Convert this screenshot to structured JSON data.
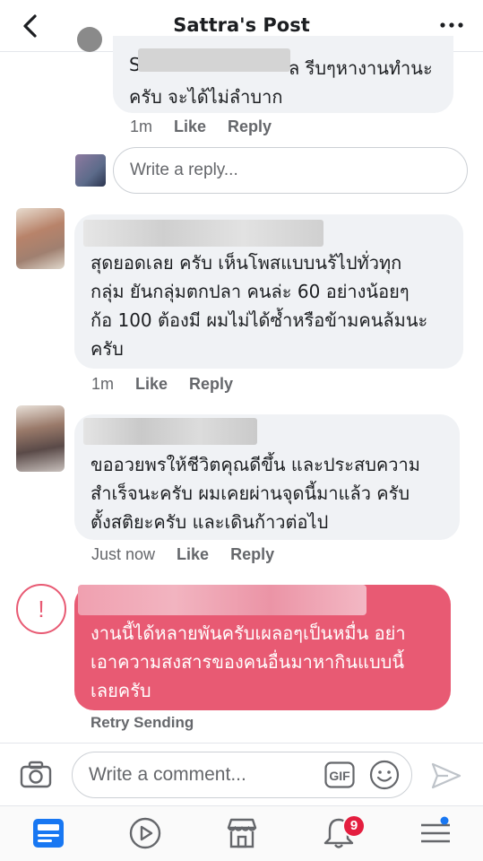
{
  "header": {
    "title": "Sattra's Post"
  },
  "comments": [
    {
      "name_initial": "S",
      "text_tail": "ล รีบๆหางานทำนะ",
      "text2": "ครับ จะได้ไม่ลำบาก",
      "time": "1m",
      "like": "Like",
      "reply": "Reply"
    },
    {
      "text": "สุดยอดเลย ครับ เห็นโพสแบบนร้ไปทั่วทุก\nกลุ่ม ยันกลุ่มตกปลา คนล่ะ 60 อย่างน้อยๆ\nก้อ 100 ต้องมี ผมไม่ได้ซ้ำหรือข้ามคนล้มนะ\nครับ",
      "time": "1m",
      "like": "Like",
      "reply": "Reply"
    },
    {
      "text": "ขออวยพรให้ชีวิตคุณดีขึ้น และประสบความ\nสำเร็จนะครับ ผมเคยผ่านจุดนี้มาแล้ว ครับ\nตั้งสติยะครับ และเดินก้าวต่อไป",
      "time": "Just now",
      "like": "Like",
      "reply": "Reply"
    }
  ],
  "reply_box": {
    "placeholder": "Write a reply..."
  },
  "failed_comment": {
    "text": "งานนี้ได้หลายพันครับเผลอๆเป็นหมื่น อย่า\nเอาความสงสารของคนอื่นมาหากินแบบนี้\nเลยครับ",
    "status": "Retry Sending",
    "alert": "!"
  },
  "composer": {
    "placeholder": "Write a comment...",
    "gif": "GIF"
  },
  "tabbar": {
    "notification_count": "9"
  },
  "colors": {
    "failed": "#e85a73",
    "badge": "#e41e3f",
    "active_tab": "#1877f2"
  }
}
